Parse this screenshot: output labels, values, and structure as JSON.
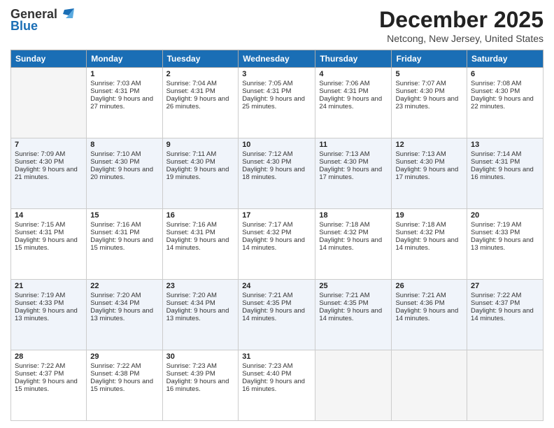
{
  "logo": {
    "general": "General",
    "blue": "Blue"
  },
  "header": {
    "month": "December 2025",
    "location": "Netcong, New Jersey, United States"
  },
  "days_of_week": [
    "Sunday",
    "Monday",
    "Tuesday",
    "Wednesday",
    "Thursday",
    "Friday",
    "Saturday"
  ],
  "weeks": [
    [
      {
        "day": "",
        "sunrise": "",
        "sunset": "",
        "daylight": "",
        "empty": true
      },
      {
        "day": "1",
        "sunrise": "Sunrise: 7:03 AM",
        "sunset": "Sunset: 4:31 PM",
        "daylight": "Daylight: 9 hours and 27 minutes."
      },
      {
        "day": "2",
        "sunrise": "Sunrise: 7:04 AM",
        "sunset": "Sunset: 4:31 PM",
        "daylight": "Daylight: 9 hours and 26 minutes."
      },
      {
        "day": "3",
        "sunrise": "Sunrise: 7:05 AM",
        "sunset": "Sunset: 4:31 PM",
        "daylight": "Daylight: 9 hours and 25 minutes."
      },
      {
        "day": "4",
        "sunrise": "Sunrise: 7:06 AM",
        "sunset": "Sunset: 4:31 PM",
        "daylight": "Daylight: 9 hours and 24 minutes."
      },
      {
        "day": "5",
        "sunrise": "Sunrise: 7:07 AM",
        "sunset": "Sunset: 4:30 PM",
        "daylight": "Daylight: 9 hours and 23 minutes."
      },
      {
        "day": "6",
        "sunrise": "Sunrise: 7:08 AM",
        "sunset": "Sunset: 4:30 PM",
        "daylight": "Daylight: 9 hours and 22 minutes."
      }
    ],
    [
      {
        "day": "7",
        "sunrise": "Sunrise: 7:09 AM",
        "sunset": "Sunset: 4:30 PM",
        "daylight": "Daylight: 9 hours and 21 minutes."
      },
      {
        "day": "8",
        "sunrise": "Sunrise: 7:10 AM",
        "sunset": "Sunset: 4:30 PM",
        "daylight": "Daylight: 9 hours and 20 minutes."
      },
      {
        "day": "9",
        "sunrise": "Sunrise: 7:11 AM",
        "sunset": "Sunset: 4:30 PM",
        "daylight": "Daylight: 9 hours and 19 minutes."
      },
      {
        "day": "10",
        "sunrise": "Sunrise: 7:12 AM",
        "sunset": "Sunset: 4:30 PM",
        "daylight": "Daylight: 9 hours and 18 minutes."
      },
      {
        "day": "11",
        "sunrise": "Sunrise: 7:13 AM",
        "sunset": "Sunset: 4:30 PM",
        "daylight": "Daylight: 9 hours and 17 minutes."
      },
      {
        "day": "12",
        "sunrise": "Sunrise: 7:13 AM",
        "sunset": "Sunset: 4:30 PM",
        "daylight": "Daylight: 9 hours and 17 minutes."
      },
      {
        "day": "13",
        "sunrise": "Sunrise: 7:14 AM",
        "sunset": "Sunset: 4:31 PM",
        "daylight": "Daylight: 9 hours and 16 minutes."
      }
    ],
    [
      {
        "day": "14",
        "sunrise": "Sunrise: 7:15 AM",
        "sunset": "Sunset: 4:31 PM",
        "daylight": "Daylight: 9 hours and 15 minutes."
      },
      {
        "day": "15",
        "sunrise": "Sunrise: 7:16 AM",
        "sunset": "Sunset: 4:31 PM",
        "daylight": "Daylight: 9 hours and 15 minutes."
      },
      {
        "day": "16",
        "sunrise": "Sunrise: 7:16 AM",
        "sunset": "Sunset: 4:31 PM",
        "daylight": "Daylight: 9 hours and 14 minutes."
      },
      {
        "day": "17",
        "sunrise": "Sunrise: 7:17 AM",
        "sunset": "Sunset: 4:32 PM",
        "daylight": "Daylight: 9 hours and 14 minutes."
      },
      {
        "day": "18",
        "sunrise": "Sunrise: 7:18 AM",
        "sunset": "Sunset: 4:32 PM",
        "daylight": "Daylight: 9 hours and 14 minutes."
      },
      {
        "day": "19",
        "sunrise": "Sunrise: 7:18 AM",
        "sunset": "Sunset: 4:32 PM",
        "daylight": "Daylight: 9 hours and 14 minutes."
      },
      {
        "day": "20",
        "sunrise": "Sunrise: 7:19 AM",
        "sunset": "Sunset: 4:33 PM",
        "daylight": "Daylight: 9 hours and 13 minutes."
      }
    ],
    [
      {
        "day": "21",
        "sunrise": "Sunrise: 7:19 AM",
        "sunset": "Sunset: 4:33 PM",
        "daylight": "Daylight: 9 hours and 13 minutes."
      },
      {
        "day": "22",
        "sunrise": "Sunrise: 7:20 AM",
        "sunset": "Sunset: 4:34 PM",
        "daylight": "Daylight: 9 hours and 13 minutes."
      },
      {
        "day": "23",
        "sunrise": "Sunrise: 7:20 AM",
        "sunset": "Sunset: 4:34 PM",
        "daylight": "Daylight: 9 hours and 13 minutes."
      },
      {
        "day": "24",
        "sunrise": "Sunrise: 7:21 AM",
        "sunset": "Sunset: 4:35 PM",
        "daylight": "Daylight: 9 hours and 14 minutes."
      },
      {
        "day": "25",
        "sunrise": "Sunrise: 7:21 AM",
        "sunset": "Sunset: 4:35 PM",
        "daylight": "Daylight: 9 hours and 14 minutes."
      },
      {
        "day": "26",
        "sunrise": "Sunrise: 7:21 AM",
        "sunset": "Sunset: 4:36 PM",
        "daylight": "Daylight: 9 hours and 14 minutes."
      },
      {
        "day": "27",
        "sunrise": "Sunrise: 7:22 AM",
        "sunset": "Sunset: 4:37 PM",
        "daylight": "Daylight: 9 hours and 14 minutes."
      }
    ],
    [
      {
        "day": "28",
        "sunrise": "Sunrise: 7:22 AM",
        "sunset": "Sunset: 4:37 PM",
        "daylight": "Daylight: 9 hours and 15 minutes."
      },
      {
        "day": "29",
        "sunrise": "Sunrise: 7:22 AM",
        "sunset": "Sunset: 4:38 PM",
        "daylight": "Daylight: 9 hours and 15 minutes."
      },
      {
        "day": "30",
        "sunrise": "Sunrise: 7:23 AM",
        "sunset": "Sunset: 4:39 PM",
        "daylight": "Daylight: 9 hours and 16 minutes."
      },
      {
        "day": "31",
        "sunrise": "Sunrise: 7:23 AM",
        "sunset": "Sunset: 4:40 PM",
        "daylight": "Daylight: 9 hours and 16 minutes."
      },
      {
        "day": "",
        "sunrise": "",
        "sunset": "",
        "daylight": "",
        "empty": true
      },
      {
        "day": "",
        "sunrise": "",
        "sunset": "",
        "daylight": "",
        "empty": true
      },
      {
        "day": "",
        "sunrise": "",
        "sunset": "",
        "daylight": "",
        "empty": true
      }
    ]
  ]
}
